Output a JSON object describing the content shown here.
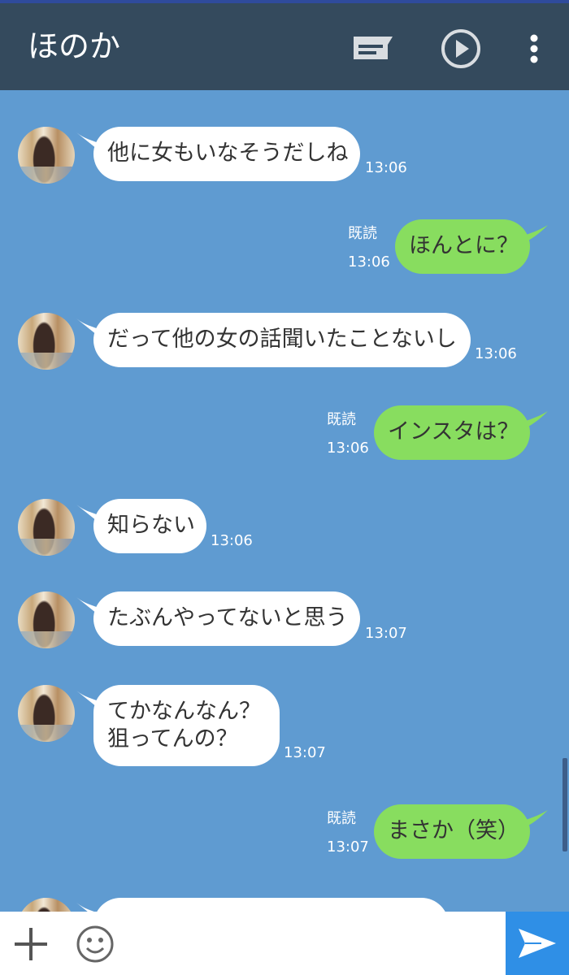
{
  "header": {
    "title": "ほのか"
  },
  "icons": {
    "chat": "chat-bubble-icon",
    "play": "play-circle-icon",
    "more": "more-vertical-icon",
    "plus": "plus-icon",
    "emoji": "smiley-icon",
    "send": "send-icon"
  },
  "colors": {
    "header": "#344a5d",
    "background": "#5f9bd1",
    "outgoing": "#88dd5f",
    "incoming": "#ffffff",
    "send": "#2f8fe6"
  },
  "read_label": "既読",
  "messages": [
    {
      "dir": "in",
      "lines": [
        "他に女もいなそうだしね"
      ],
      "time": "13:06"
    },
    {
      "dir": "out",
      "lines": [
        "ほんとに？"
      ],
      "time": "13:06",
      "read": "既読"
    },
    {
      "dir": "in",
      "lines": [
        "だって他の女の話聞いたことないし"
      ],
      "time": "13:06"
    },
    {
      "dir": "out",
      "lines": [
        "インスタは？"
      ],
      "time": "13:06",
      "read": "既読"
    },
    {
      "dir": "in",
      "lines": [
        "知らない"
      ],
      "time": "13:06"
    },
    {
      "dir": "in",
      "lines": [
        "たぶんやってないと思う"
      ],
      "time": "13:07"
    },
    {
      "dir": "in",
      "lines": [
        "てかなんなん？",
        "狙ってんの？"
      ],
      "time": "13:07"
    },
    {
      "dir": "out",
      "lines": [
        "まさか（笑）"
      ],
      "time": "13:07",
      "read": "既読"
    }
  ]
}
